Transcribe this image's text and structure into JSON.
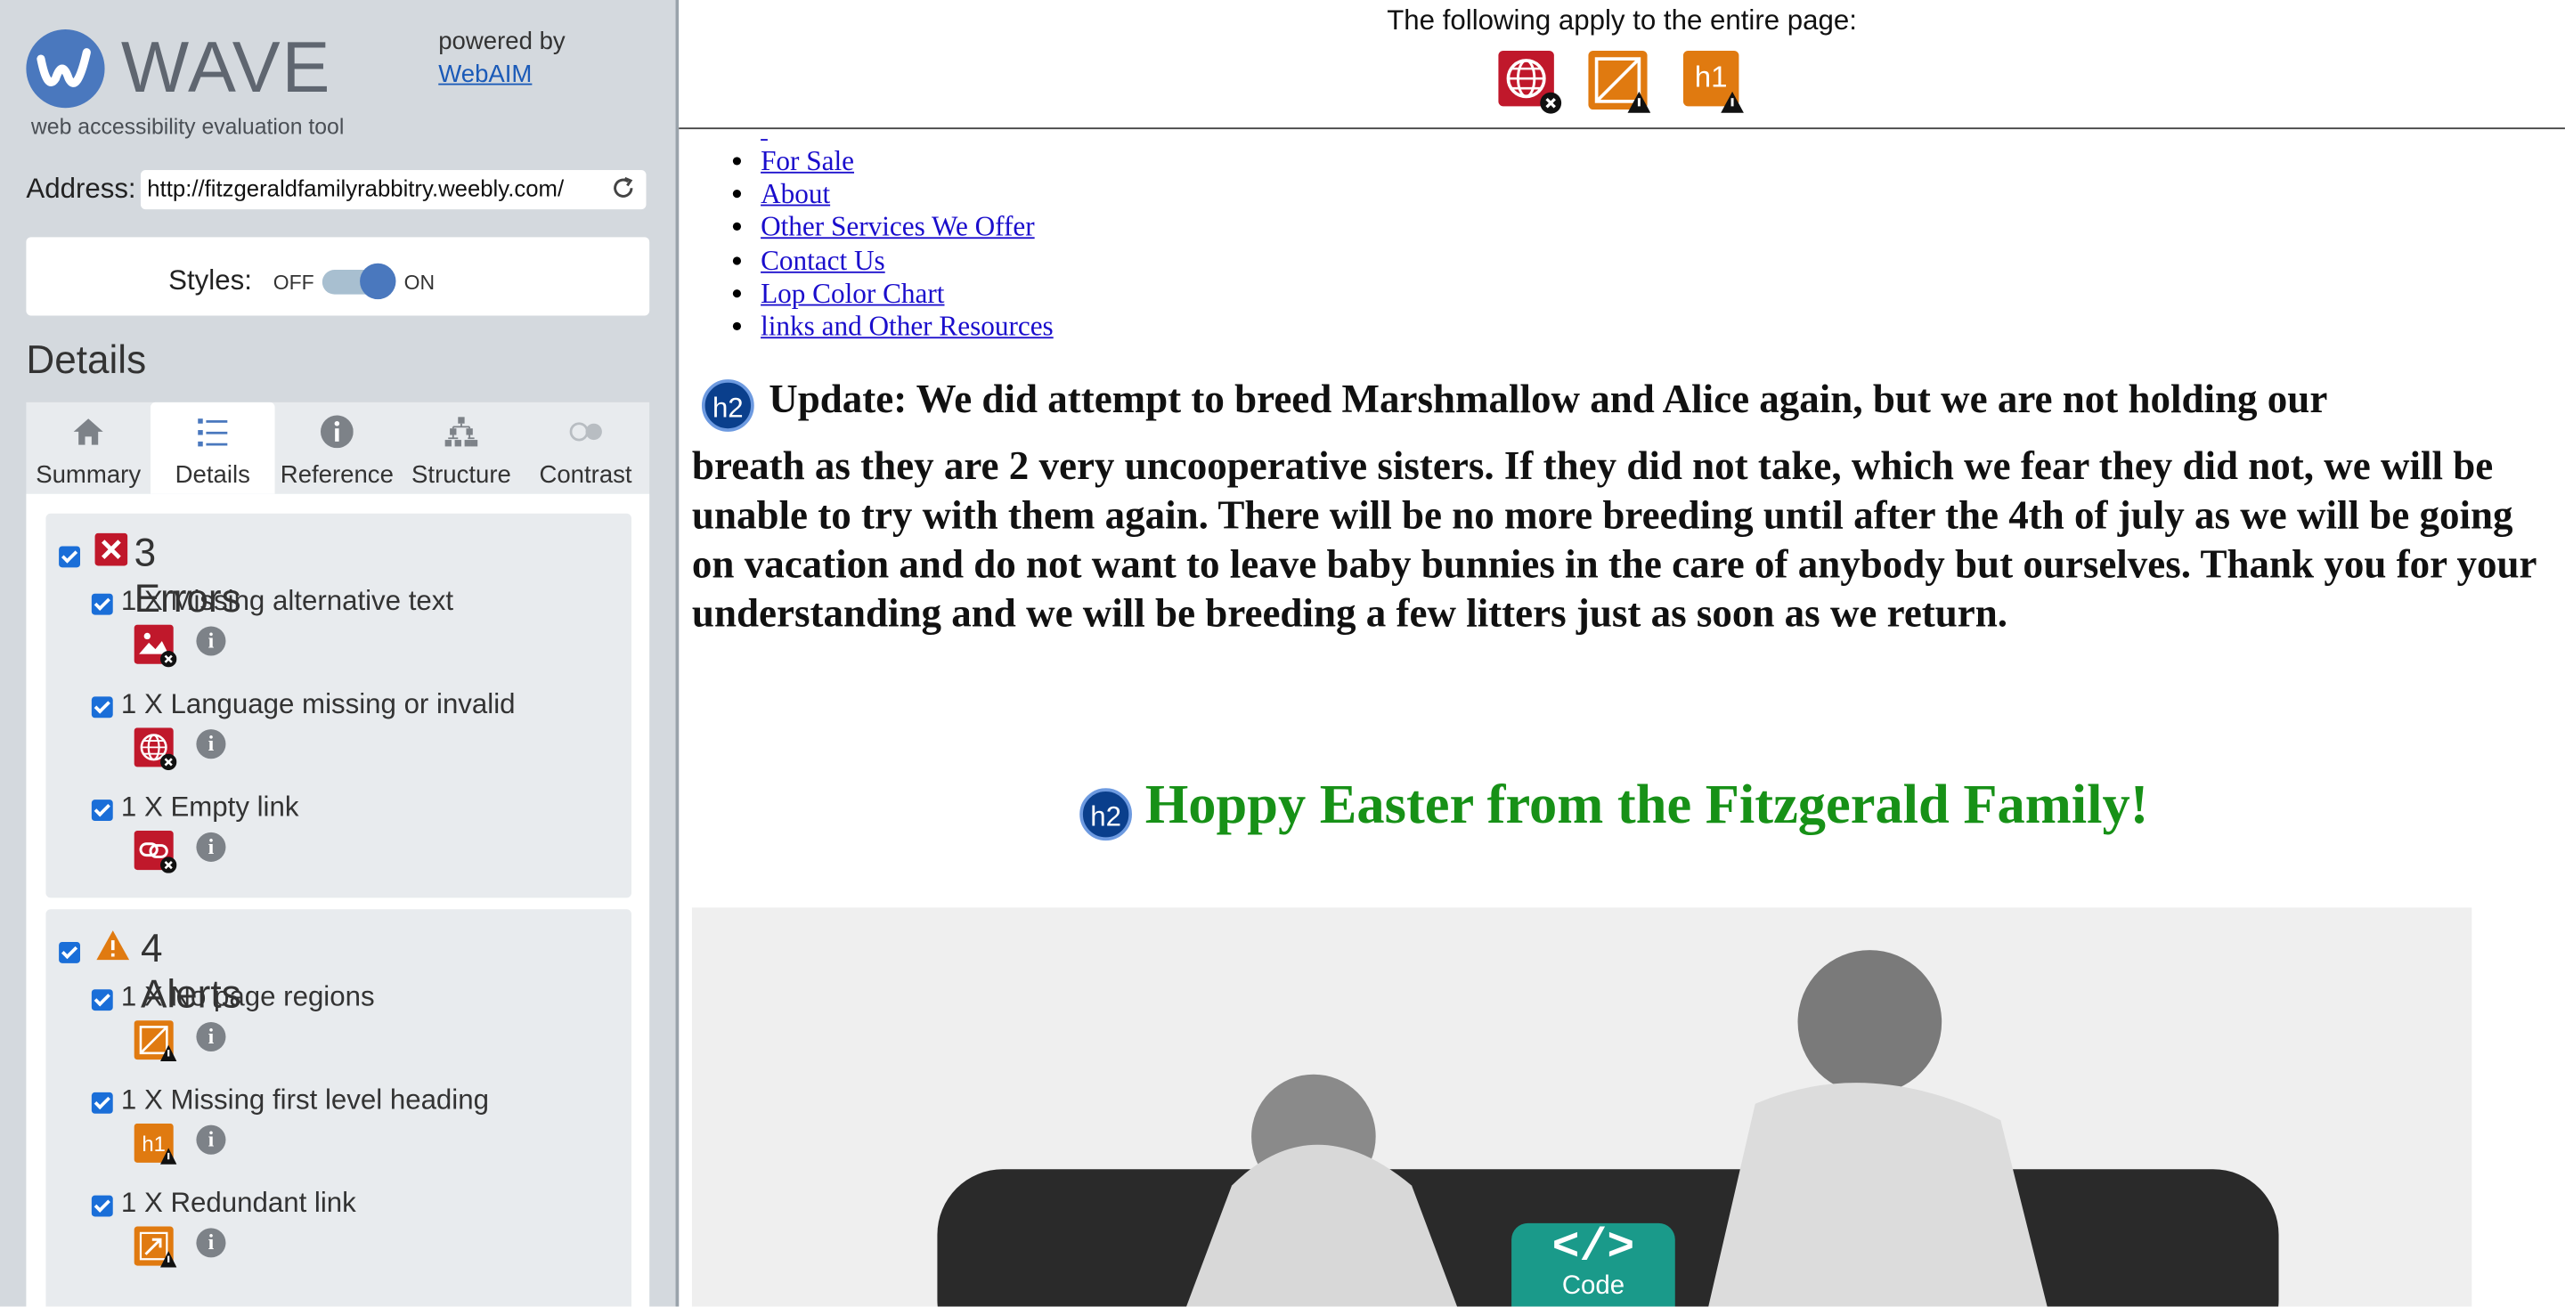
{
  "sidebar": {
    "logo_word": "WAVE",
    "tagline": "web accessibility evaluation tool",
    "powered_by": "powered by",
    "webaim_link": "WebAIM",
    "address_label": "Address:",
    "address_value": "http://fitzgeraldfamilyrabbitry.weebly.com/",
    "styles_label": "Styles:",
    "styles_off": "OFF",
    "styles_on": "ON",
    "details_heading": "Details",
    "tabs": [
      {
        "label": "Summary",
        "icon": "home-icon"
      },
      {
        "label": "Details",
        "icon": "list-icon"
      },
      {
        "label": "Reference",
        "icon": "info-icon"
      },
      {
        "label": "Structure",
        "icon": "hierarchy-icon"
      },
      {
        "label": "Contrast",
        "icon": "contrast-toggle-icon"
      }
    ],
    "errors": {
      "title": "3 Errors",
      "items": [
        {
          "label": "1 X Missing alternative text",
          "icon": "missing-alt-icon"
        },
        {
          "label": "1 X Language missing or invalid",
          "icon": "language-icon"
        },
        {
          "label": "1 X Empty link",
          "icon": "empty-link-icon"
        }
      ]
    },
    "alerts": {
      "title": "4 Alerts",
      "items": [
        {
          "label": "1 X No page regions",
          "icon": "no-regions-icon"
        },
        {
          "label": "1 X Missing first level heading",
          "icon": "h1-missing-icon"
        },
        {
          "label": "1 X Redundant link",
          "icon": "redundant-link-icon"
        }
      ]
    }
  },
  "topbar": {
    "label": "The following apply to the entire page:",
    "icons": [
      "language-error-icon",
      "no-regions-alert-icon",
      "h1-alert-icon"
    ],
    "h1_text": "h1"
  },
  "content": {
    "nav_links": [
      "For Sale",
      "About",
      "Other Services We Offer",
      "Contact Us",
      "Lop Color Chart",
      "links and Other Resources"
    ],
    "h2_badge": "h2",
    "update_first": "Update: We did attempt to breed Marshmallow and Alice again, but we are not holding our",
    "update_rest": "breath as they are 2 very uncooperative sisters. If they did not take, which we fear they did not, we will be unable to try with them again. There will be no more breeding until after the 4th of july as we will be going on vacation and do not want to leave baby bunnies in the care of anybody but ourselves. Thank you for your understanding and we will be breeding a few litters just as soon as we return.",
    "easter_heading": "Hoppy Easter from the Fitzgerald Family!",
    "code_glyph": "</>",
    "code_label": "Code"
  },
  "colors": {
    "wave_blue": "#4a78be",
    "error_red": "#c0182b",
    "alert_orange": "#e07a10",
    "heading_green": "#179117",
    "code_teal": "#1a9a8a"
  }
}
